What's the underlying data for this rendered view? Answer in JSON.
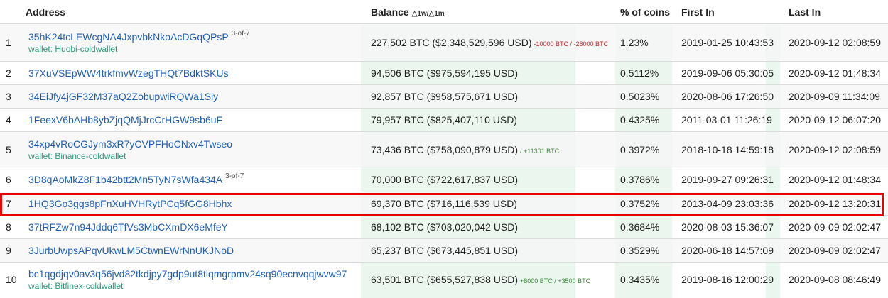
{
  "header": {
    "address": "Address",
    "balance": "Balance",
    "balance_sub": "△1w/△1m",
    "pct": "% of coins",
    "first_in": "First In",
    "last_in": "Last In"
  },
  "rows": [
    {
      "idx": "1",
      "address": "35hK24tcLEWcgNA4JxpvbkNkoAcDGqQPsP",
      "multisig": "3-of-7",
      "wallet": "wallet: Huobi-coldwallet",
      "balance": "227,502 BTC ($2,348,529,596 USD)",
      "delta": "-10000 BTC / -28000 BTC",
      "delta_type": "neg",
      "pct": "1.23%",
      "first_in": "2019-01-25 10:43:53",
      "last_in": "2020-09-12 02:08:59"
    },
    {
      "idx": "2",
      "address": "37XuVSEpWW4trkfmvWzegTHQt7BdktSKUs",
      "multisig": "",
      "wallet": "",
      "balance": "94,506 BTC ($975,594,195 USD)",
      "delta": "",
      "delta_type": "",
      "pct": "0.5112%",
      "first_in": "2019-09-06 05:30:05",
      "last_in": "2020-09-12 01:48:34"
    },
    {
      "idx": "3",
      "address": "34EiJfy4jGF32M37aQ2ZobupwiRQWa1Siy",
      "multisig": "",
      "wallet": "",
      "balance": "92,857 BTC ($958,575,671 USD)",
      "delta": "",
      "delta_type": "",
      "pct": "0.5023%",
      "first_in": "2020-08-06 17:26:50",
      "last_in": "2020-09-09 11:34:09"
    },
    {
      "idx": "4",
      "address": "1FeexV6bAHb8ybZjqQMjJrcCrHGW9sb6uF",
      "multisig": "",
      "wallet": "",
      "balance": "79,957 BTC ($825,407,110 USD)",
      "delta": "",
      "delta_type": "",
      "pct": "0.4325%",
      "first_in": "2011-03-01 11:26:19",
      "last_in": "2020-09-12 06:07:20"
    },
    {
      "idx": "5",
      "address": "34xp4vRoCGJym3xR7yCVPFHoCNxv4Twseo",
      "multisig": "",
      "wallet": "wallet: Binance-coldwallet",
      "balance": "73,436 BTC ($758,090,879 USD)",
      "delta": "/ +11301 BTC",
      "delta_type": "pos",
      "pct": "0.3972%",
      "first_in": "2018-10-18 14:59:18",
      "last_in": "2020-09-12 02:08:59"
    },
    {
      "idx": "6",
      "address": "3D8qAoMkZ8F1b42btt2Mn5TyN7sWfa434A",
      "multisig": "3-of-7",
      "wallet": "",
      "balance": "70,000 BTC ($722,617,837 USD)",
      "delta": "",
      "delta_type": "",
      "pct": "0.3786%",
      "first_in": "2019-09-27 09:26:31",
      "last_in": "2020-09-12 01:48:34"
    },
    {
      "idx": "7",
      "address": "1HQ3Go3ggs8pFnXuHVHRytPCq5fGG8Hbhx",
      "multisig": "",
      "wallet": "",
      "balance": "69,370 BTC ($716,116,539 USD)",
      "delta": "",
      "delta_type": "",
      "pct": "0.3752%",
      "first_in": "2013-04-09 23:03:36",
      "last_in": "2020-09-12 13:20:31"
    },
    {
      "idx": "8",
      "address": "37tRFZw7n94Jddq6TfVs3MbCXmDX6eMfeY",
      "multisig": "",
      "wallet": "",
      "balance": "68,102 BTC ($703,020,042 USD)",
      "delta": "",
      "delta_type": "",
      "pct": "0.3684%",
      "first_in": "2020-08-03 15:36:07",
      "last_in": "2020-09-09 02:02:47"
    },
    {
      "idx": "9",
      "address": "3JurbUwpsAPqvUkwLM5CtwnEWrNnUKJNoD",
      "multisig": "",
      "wallet": "",
      "balance": "65,237 BTC ($673,445,851 USD)",
      "delta": "",
      "delta_type": "",
      "pct": "0.3529%",
      "first_in": "2020-06-18 14:57:09",
      "last_in": "2020-09-09 02:02:47"
    },
    {
      "idx": "10",
      "address": "bc1qgdjqv0av3q56jvd82tkdjpy7gdp9ut8tlqmgrpmv24sq90ecnvqqjwvw97",
      "multisig": "",
      "wallet": "wallet: Bitfinex-coldwallet",
      "balance": "63,501 BTC ($655,527,838 USD)",
      "delta": "+8000 BTC / +3500 BTC",
      "delta_type": "pos",
      "pct": "0.3435%",
      "first_in": "2019-08-16 12:00:29",
      "last_in": "2020-09-08 08:46:49"
    }
  ],
  "colors": {
    "link": "#1f5fb8",
    "wallet": "#2a9a7a",
    "delta_neg": "#c03030",
    "delta_pos": "#3a8a3a",
    "highlight": "#ee0000"
  }
}
